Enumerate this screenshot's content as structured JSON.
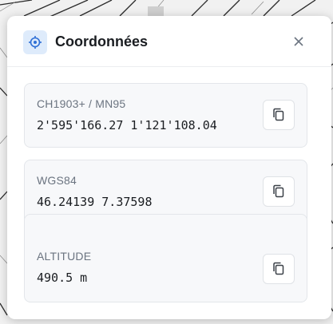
{
  "panel": {
    "title": "Coordonnées",
    "header_icon": "crosshair-icon",
    "close_icon": "close-icon",
    "accent_color": "#2e6fd6"
  },
  "coordinates": [
    {
      "label": "CH1903+ / MN95",
      "value": "2'595'166.27 1'121'108.04",
      "copy_icon": "copy-icon"
    },
    {
      "label": "WGS84",
      "value": "46.24139 7.37598",
      "copy_icon": "copy-icon"
    },
    {
      "label": "ALTITUDE",
      "value": "490.5 m",
      "copy_icon": "copy-icon"
    }
  ]
}
